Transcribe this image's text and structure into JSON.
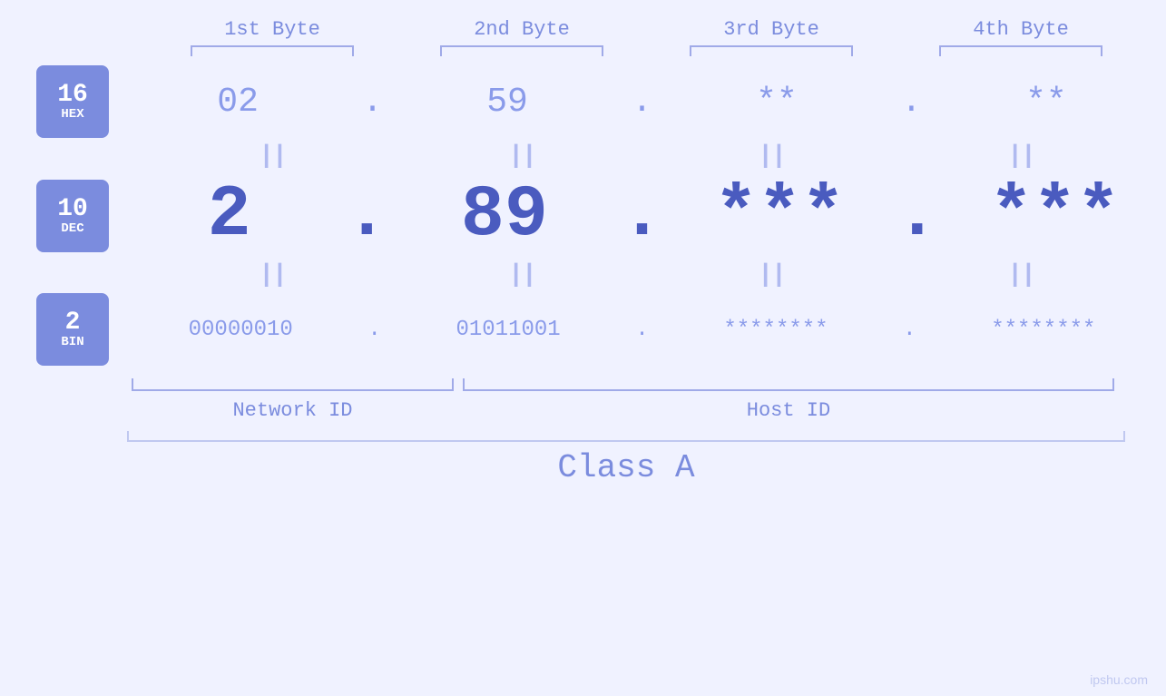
{
  "page": {
    "background": "#f0f2ff",
    "watermark": "ipshu.com"
  },
  "byte_labels": {
    "b1": "1st Byte",
    "b2": "2nd Byte",
    "b3": "3rd Byte",
    "b4": "4th Byte"
  },
  "badges": {
    "hex": {
      "number": "16",
      "label": "HEX"
    },
    "dec": {
      "number": "10",
      "label": "DEC"
    },
    "bin": {
      "number": "2",
      "label": "BIN"
    }
  },
  "hex_values": {
    "b1": "02",
    "b2": "59",
    "b3": "**",
    "b4": "**"
  },
  "dec_values": {
    "b1": "2",
    "b2": "89",
    "b3": "***",
    "b4": "***"
  },
  "bin_values": {
    "b1": "00000010",
    "b2": "01011001",
    "b3": "********",
    "b4": "********"
  },
  "labels": {
    "network_id": "Network ID",
    "host_id": "Host ID",
    "class": "Class A"
  },
  "dot": "."
}
